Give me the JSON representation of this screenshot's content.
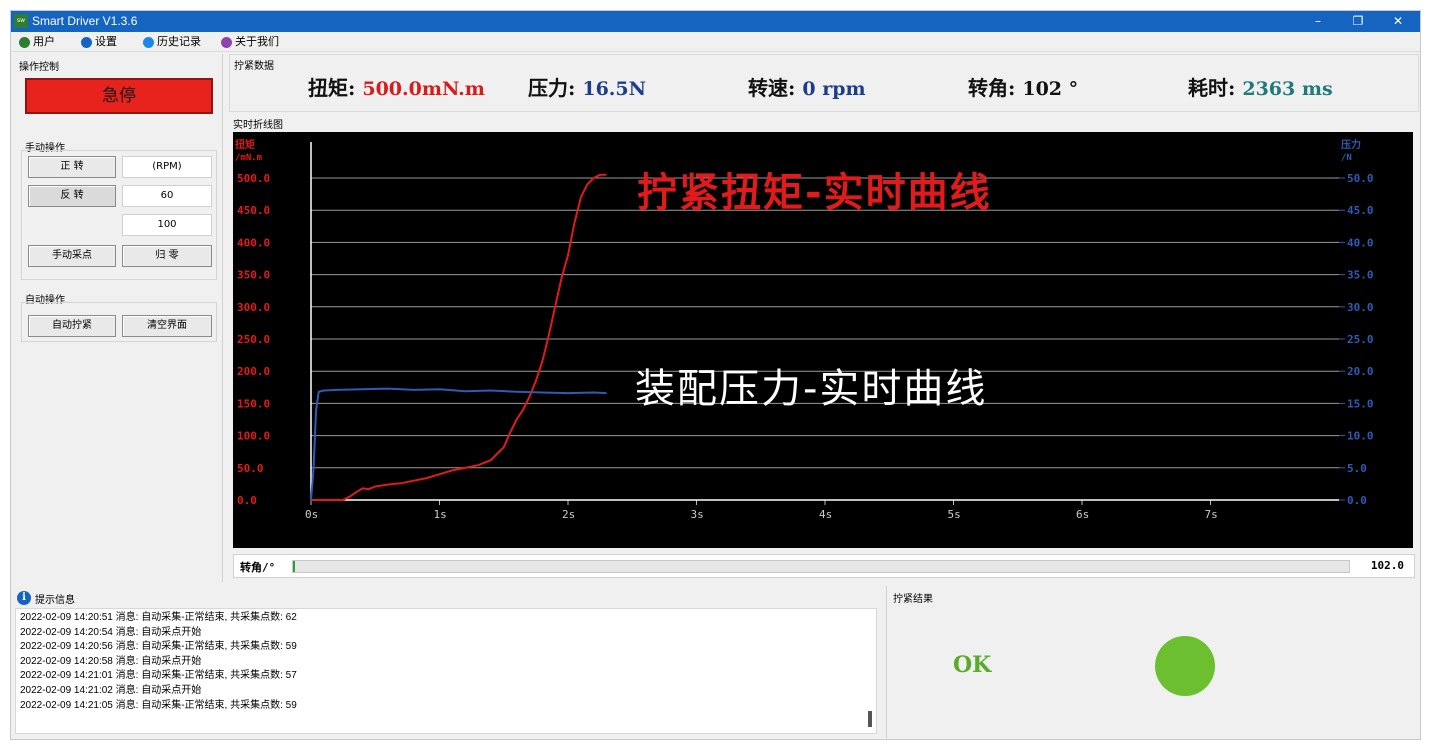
{
  "window": {
    "app_icon": "sw",
    "title": "Smart Driver V1.3.6",
    "minimize": "–",
    "maximize": "❐",
    "close": "✕"
  },
  "menu": [
    {
      "label": "用户",
      "icon": "user-icon",
      "color": "#2e7d32"
    },
    {
      "label": "设置",
      "icon": "settings-icon",
      "color": "#1565c0"
    },
    {
      "label": "历史记录",
      "icon": "history-icon",
      "color": "#1e88e5"
    },
    {
      "label": "关于我们",
      "icon": "about-icon",
      "color": "#8e44ad"
    }
  ],
  "control": {
    "title": "操作控制",
    "estop": "急停",
    "manual_title": "手动操作",
    "forward": "正 转",
    "reverse": "反 转",
    "rpm_unit": "(RPM)",
    "speed_a": "60",
    "speed_b": "100",
    "manual_sample": "手动采点",
    "zero": "归 零",
    "auto_title": "自动操作",
    "auto_tighten": "自动拧紧",
    "clear": "清空界面"
  },
  "readings": {
    "title": "拧紧数据",
    "torque_label": "扭矩:",
    "torque_value": "500.0mN.m",
    "pressure_label": "压力:",
    "pressure_value": "16.5N",
    "speed_label": "转速:",
    "speed_value": "0 rpm",
    "angle_label": "转角:",
    "angle_value": "102 °",
    "time_label": "耗时:",
    "time_value": "2363 ms",
    "colors": {
      "torque": "#d81c1c",
      "pressure": "#1e3c8c",
      "speed": "#1e3c8c",
      "angle": "#111111",
      "time": "#1f7a7a"
    }
  },
  "chart_data": {
    "type": "line",
    "title": "实时折线图",
    "left_axis_label": [
      "扭矩",
      "/mN.m"
    ],
    "right_axis_label": [
      "压力",
      "/N"
    ],
    "left_ylim": [
      0,
      500
    ],
    "right_ylim": [
      0,
      50
    ],
    "left_ticks": [
      "0.0",
      "50.0",
      "100.0",
      "150.0",
      "200.0",
      "250.0",
      "300.0",
      "350.0",
      "400.0",
      "450.0",
      "500.0"
    ],
    "right_ticks": [
      "0.0",
      "5.0",
      "10.0",
      "15.0",
      "20.0",
      "25.0",
      "30.0",
      "35.0",
      "40.0",
      "45.0",
      "50.0"
    ],
    "xlim": [
      0,
      8
    ],
    "x_ticks": [
      "0s",
      "1s",
      "2s",
      "3s",
      "4s",
      "5s",
      "6s",
      "7s"
    ],
    "grid": true,
    "annotations": [
      {
        "text": "拧紧扭矩-实时曲线",
        "color": "#e11b1b"
      },
      {
        "text": "装配压力-实时曲线",
        "color": "#ffffff"
      }
    ],
    "series": [
      {
        "axis": "left",
        "color": "#e11b1b",
        "x": [
          0,
          0.25,
          0.3,
          0.35,
          0.4,
          0.45,
          0.5,
          0.6,
          0.7,
          0.8,
          0.9,
          1.0,
          1.1,
          1.2,
          1.3,
          1.4,
          1.45,
          1.5,
          1.55,
          1.6,
          1.65,
          1.7,
          1.75,
          1.8,
          1.85,
          1.9,
          1.95,
          2.0,
          2.05,
          2.1,
          2.15,
          2.2,
          2.25,
          2.3
        ],
        "y": [
          0,
          0,
          5,
          12,
          18,
          17,
          21,
          24,
          26,
          30,
          34,
          40,
          46,
          50,
          54,
          62,
          72,
          82,
          105,
          125,
          140,
          160,
          185,
          215,
          255,
          300,
          345,
          380,
          430,
          470,
          490,
          500,
          505,
          505
        ]
      },
      {
        "axis": "right",
        "color": "#2f5bb5",
        "x": [
          0,
          0.02,
          0.04,
          0.06,
          0.1,
          0.2,
          0.4,
          0.6,
          0.8,
          1.0,
          1.2,
          1.4,
          1.6,
          1.8,
          2.0,
          2.2,
          2.3
        ],
        "y": [
          0,
          5,
          14,
          16.8,
          17.0,
          17.1,
          17.2,
          17.3,
          17.1,
          17.2,
          16.9,
          17.0,
          16.8,
          16.7,
          16.6,
          16.7,
          16.6
        ]
      }
    ]
  },
  "angle_bar": {
    "label": "转角/°",
    "value": "102.0",
    "fill_fraction": 0.002
  },
  "messages": {
    "title": "提示信息",
    "items": [
      "2022-02-09 14:20:51 消息: 自动采集-正常结束, 共采集点数: 62",
      "2022-02-09 14:20:54 消息: 自动采点开始",
      "2022-02-09 14:20:56 消息: 自动采集-正常结束, 共采集点数: 59",
      "2022-02-09 14:20:58 消息: 自动采点开始",
      "2022-02-09 14:21:01 消息: 自动采集-正常结束, 共采集点数: 57",
      "2022-02-09 14:21:02 消息: 自动采点开始",
      "2022-02-09 14:21:05 消息: 自动采集-正常结束, 共采集点数: 59"
    ]
  },
  "result": {
    "title": "拧紧结果",
    "text": "OK",
    "lamp_color": "#6cbf2f"
  }
}
